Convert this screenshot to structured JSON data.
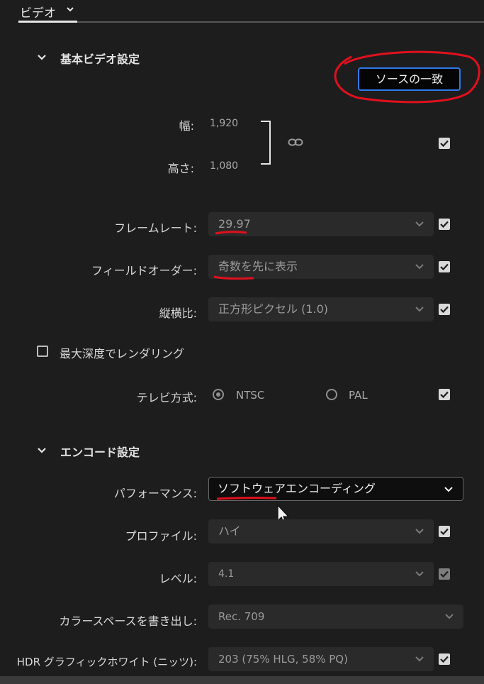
{
  "tab": {
    "label": "ビデオ"
  },
  "basic": {
    "title": "基本ビデオ設定",
    "match_source_label": "ソースの一致",
    "width": {
      "label": "幅:",
      "value": "1,920"
    },
    "height": {
      "label": "高さ:",
      "value": "1,080"
    },
    "frame_rate": {
      "label": "フレームレート:",
      "value": "29.97"
    },
    "field_order": {
      "label": "フィールドオーダー:",
      "value": "奇数を先に表示"
    },
    "aspect": {
      "label": "縦横比:",
      "value": "正方形ピクセル (1.0)"
    },
    "max_depth": {
      "label": "最大深度でレンダリング",
      "checked": false
    },
    "tv_standard": {
      "label": "テレビ方式:",
      "options": [
        "NTSC",
        "PAL"
      ],
      "selected": "NTSC"
    }
  },
  "encode": {
    "title": "エンコード設定",
    "performance": {
      "label": "パフォーマンス:",
      "value": "ソフトウェアエンコーディング"
    },
    "profile": {
      "label": "プロファイル:",
      "value": "ハイ"
    },
    "level": {
      "label": "レベル:",
      "value": "4.1"
    },
    "color_space": {
      "label": "カラースペースを書き出し:",
      "value": "Rec. 709"
    },
    "hdr_white": {
      "label": "HDR グラフィックホワイト (ニッツ):",
      "value": "203 (75% HLG, 58% PQ)"
    }
  },
  "colors": {
    "accent_blue": "#2f79e6",
    "annotation_red": "#e0101e",
    "background": "#1d1d1d"
  },
  "icons": [
    "chevron-down-icon",
    "link-icon",
    "checkmark-icon",
    "mouse-cursor-icon"
  ]
}
